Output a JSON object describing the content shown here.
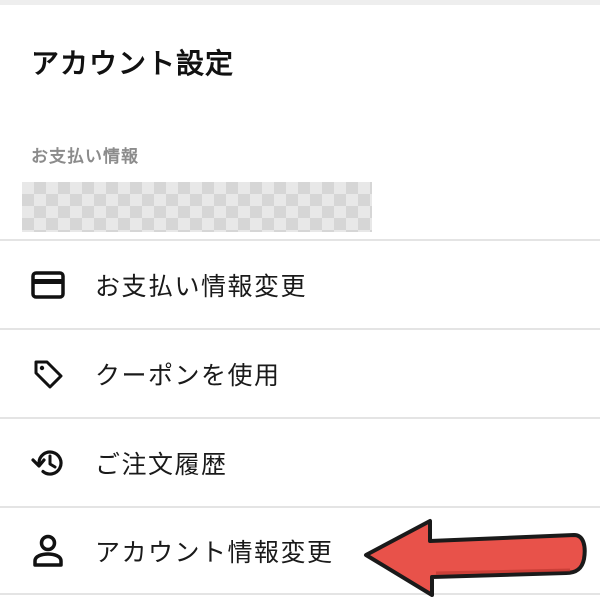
{
  "header": {
    "title": "アカウント設定"
  },
  "payment_info": {
    "section_label": "お支払い情報",
    "value_redacted": true
  },
  "menu": {
    "items": [
      {
        "label": "お支払い情報変更",
        "icon": "credit-card-icon"
      },
      {
        "label": "クーポンを使用",
        "icon": "tag-icon"
      },
      {
        "label": "ご注文履歴",
        "icon": "history-icon"
      },
      {
        "label": "アカウント情報変更",
        "icon": "person-icon"
      }
    ]
  },
  "annotation": {
    "type": "red-arrow",
    "points_to": "アカウント情報変更",
    "color": "#e8524a"
  }
}
